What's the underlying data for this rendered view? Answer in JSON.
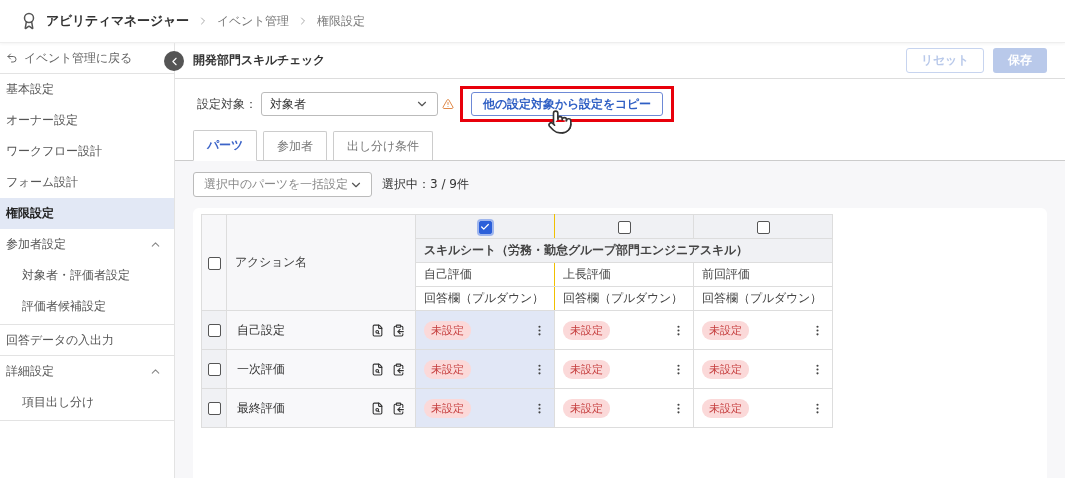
{
  "breadcrumb": {
    "app": "アビリティマネージャー",
    "items": [
      "イベント管理",
      "権限設定"
    ]
  },
  "sidebar": {
    "back": "イベント管理に戻る",
    "items": [
      {
        "label": "基本設定",
        "selected": false
      },
      {
        "label": "オーナー設定",
        "selected": false
      },
      {
        "label": "ワークフロー設計",
        "selected": false
      },
      {
        "label": "フォーム設計",
        "selected": false
      },
      {
        "label": "権限設定",
        "selected": true
      },
      {
        "label": "参加者設定",
        "selected": false,
        "expanded": true,
        "children": [
          {
            "label": "対象者・評価者設定",
            "selected": false
          },
          {
            "label": "評価者候補設定",
            "selected": false
          }
        ]
      },
      {
        "label": "回答データの入出力",
        "selected": false
      },
      {
        "label": "詳細設定",
        "selected": false,
        "expanded": true,
        "children": [
          {
            "label": "項目出し分け",
            "selected": false
          }
        ]
      }
    ]
  },
  "page": {
    "title": "開発部門スキルチェック",
    "buttons": [
      {
        "label": "リセット",
        "kind": "outline",
        "disabled": true
      },
      {
        "label": "保存",
        "kind": "primary",
        "disabled": true
      }
    ]
  },
  "target": {
    "label": "設定対象：",
    "value": "対象者",
    "warning": true
  },
  "copy_button": {
    "label": "他の設定対象から設定をコピー",
    "highlighted": true
  },
  "tabs": [
    {
      "label": "パーツ",
      "selected": true
    },
    {
      "label": "参加者",
      "selected": false
    },
    {
      "label": "出し分け条件",
      "selected": false
    }
  ],
  "bulk": {
    "placeholder": "選択中のパーツを一括設定",
    "count": "選択中：3 / 9件"
  },
  "table": {
    "header_label": "アクション名",
    "all_checked": false,
    "group": "スキルシート（労務・勤怠グループ部門エンジニアスキル）",
    "columns": [
      {
        "checked": true,
        "name": "自己評価",
        "type": "回答欄（プルダウン）"
      },
      {
        "checked": false,
        "name": "上長評価",
        "type": "回答欄（プルダウン）"
      },
      {
        "checked": false,
        "name": "前回評価",
        "type": "回答欄（プルダウン）"
      }
    ],
    "rows": [
      {
        "checked": false,
        "name": "自己設定",
        "cells": [
          "未設定",
          "未設定",
          "未設定"
        ]
      },
      {
        "checked": false,
        "name": "一次評価",
        "cells": [
          "未設定",
          "未設定",
          "未設定"
        ]
      },
      {
        "checked": false,
        "name": "最終評価",
        "cells": [
          "未設定",
          "未設定",
          "未設定"
        ]
      }
    ]
  }
}
